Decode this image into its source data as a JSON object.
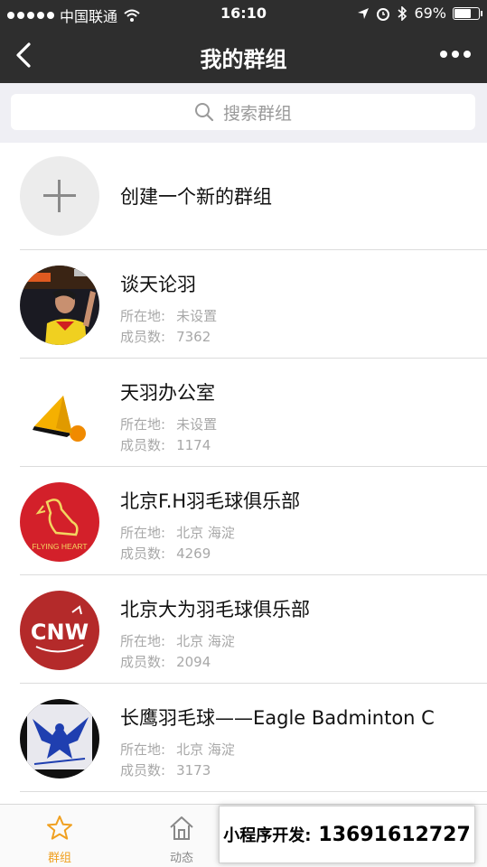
{
  "status_bar": {
    "carrier": "中国联通",
    "time": "16:10",
    "battery": "69%",
    "battery_level": 0.69
  },
  "nav": {
    "title": "我的群组",
    "back_icon": "back-chevron-icon",
    "more_icon": "more-dots-icon"
  },
  "search": {
    "placeholder": "搜索群组"
  },
  "create": {
    "label": "创建一个新的群组"
  },
  "groups": [
    {
      "name": "谈天论羽",
      "loc_key": "所在地:",
      "loc_val": "未设置",
      "cnt_key": "成员数:",
      "cnt_val": "7362"
    },
    {
      "name": "天羽办公室",
      "loc_key": "所在地:",
      "loc_val": "未设置",
      "cnt_key": "成员数:",
      "cnt_val": "1174"
    },
    {
      "name": "北京F.H羽毛球俱乐部",
      "loc_key": "所在地:",
      "loc_val": "北京 海淀",
      "cnt_key": "成员数:",
      "cnt_val": "4269"
    },
    {
      "name": "北京大为羽毛球俱乐部",
      "loc_key": "所在地:",
      "loc_val": "北京 海淀",
      "cnt_key": "成员数:",
      "cnt_val": "2094"
    },
    {
      "name": "长鹰羽毛球——Eagle Badminton C",
      "loc_key": "所在地:",
      "loc_val": "北京 海淀",
      "cnt_key": "成员数:",
      "cnt_val": "3173"
    }
  ],
  "avatar_text": {
    "fh": "FLYING HEART",
    "cnw": "CNW"
  },
  "tabs": [
    {
      "label": "群组",
      "icon": "star-icon",
      "active": true
    },
    {
      "label": "动态",
      "icon": "home-icon",
      "active": false
    }
  ],
  "promo": {
    "label": "小程序开发:",
    "phone": "13691612727"
  },
  "colors": {
    "bar": "#2e2e2e",
    "accent": "#f0a020",
    "fh_red": "#d3202a",
    "cnw_red": "#b42a2a"
  }
}
